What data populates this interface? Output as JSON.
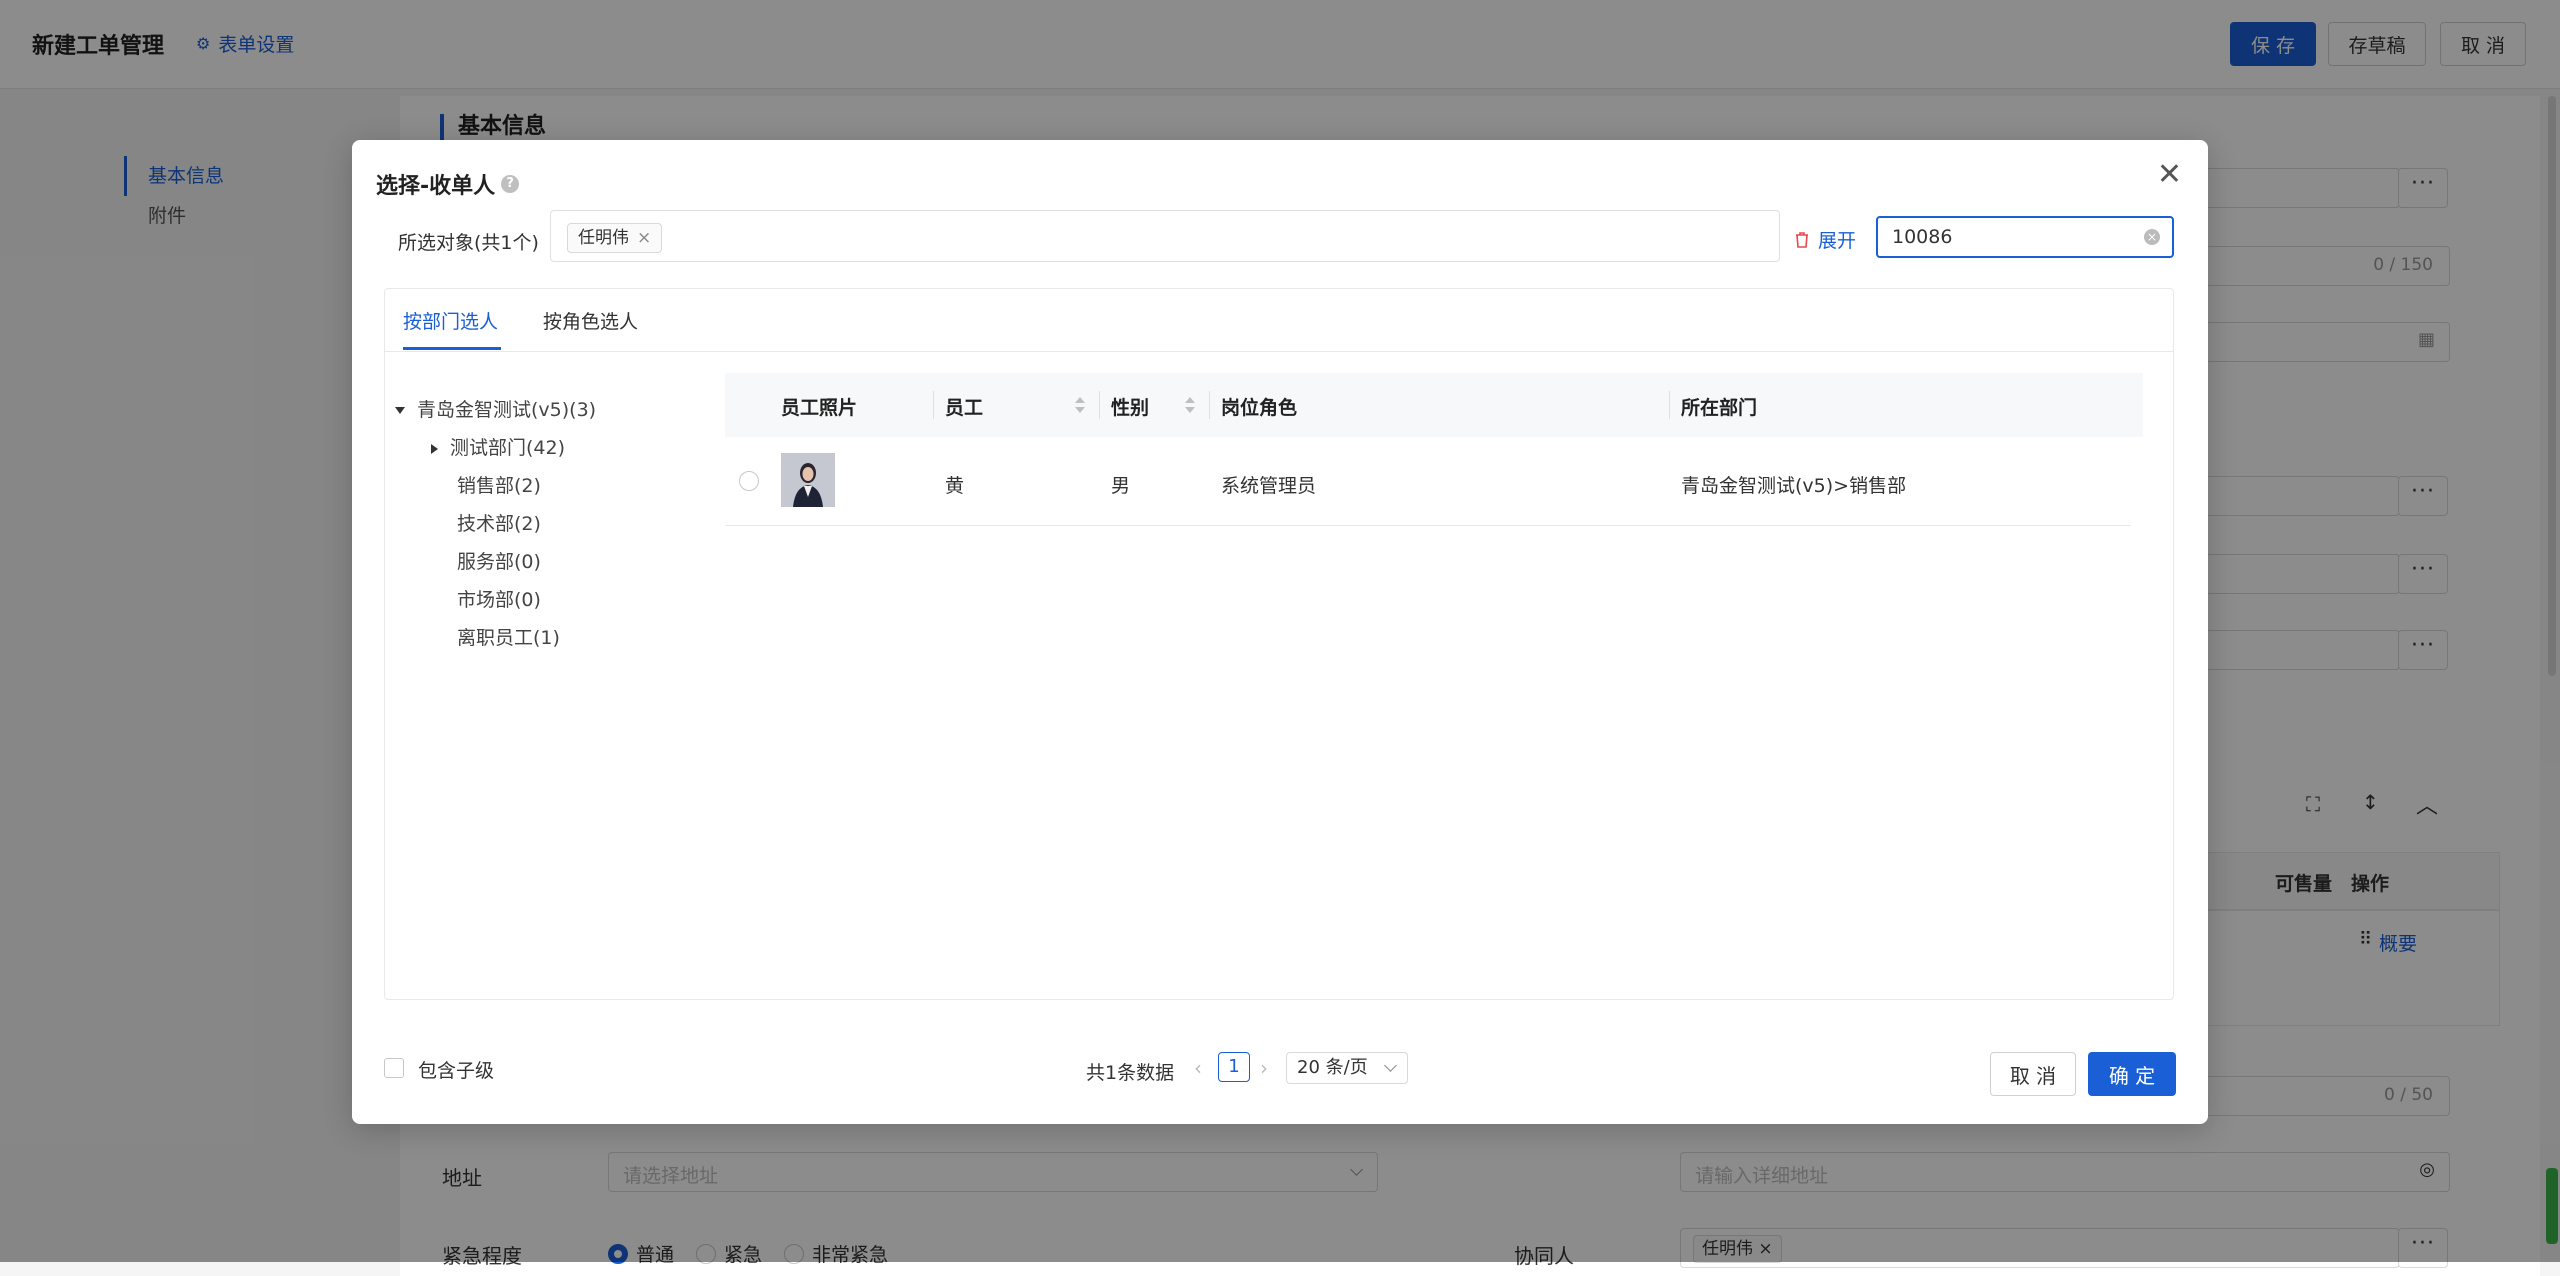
{
  "header": {
    "title": "新建工单管理",
    "form_settings": "表单设置",
    "save": "保 存",
    "draft": "存草稿",
    "cancel": "取 消"
  },
  "leftnav": {
    "items": [
      "基本信息",
      "附件"
    ],
    "active": 0
  },
  "form": {
    "section_title": "基本信息",
    "counter_1": "0 / 150",
    "counter_2": "0 / 50",
    "address_label": "地址",
    "address_placeholder": "请选择地址",
    "detail_placeholder": "请输入详细地址",
    "urgency_label": "紧急程度",
    "urgency_options": [
      "普通",
      "紧急",
      "非常紧急"
    ],
    "urgency_selected": 0,
    "collaborator_label": "协同人",
    "collaborator_tag": "任明伟",
    "subtable_headers": [
      "可售量",
      "操作"
    ],
    "subtable_action": "概要"
  },
  "modal": {
    "title": "选择-收单人",
    "selected_label": "所选对象(共1个)",
    "selected_tags": [
      "任明伟"
    ],
    "expand_label": "展开",
    "search_value": "10086",
    "tabs": [
      "按部门选人",
      "按角色选人"
    ],
    "active_tab": 0,
    "tree": {
      "root": "青岛金智测试(v5)(3)",
      "children": [
        {
          "label": "测试部门(42)",
          "has_children": true
        },
        {
          "label": "销售部(2)",
          "has_children": false
        },
        {
          "label": "技术部(2)",
          "has_children": false
        },
        {
          "label": "服务部(0)",
          "has_children": false
        },
        {
          "label": "市场部(0)",
          "has_children": false
        },
        {
          "label": "离职员工(1)",
          "has_children": false
        }
      ]
    },
    "table": {
      "columns": [
        "员工照片",
        "员工",
        "性别",
        "岗位角色",
        "所在部门"
      ],
      "rows": [
        {
          "name": "黄",
          "gender": "男",
          "role": "系统管理员",
          "dept": "青岛金智测试(v5)>销售部"
        }
      ]
    },
    "footer": {
      "include_sub": "包含子级",
      "total": "共1条数据",
      "current_page": "1",
      "page_size": "20 条/页",
      "cancel": "取 消",
      "ok": "确 定"
    }
  },
  "colors": {
    "primary": "#1a5fd6",
    "danger": "#e5484d"
  }
}
